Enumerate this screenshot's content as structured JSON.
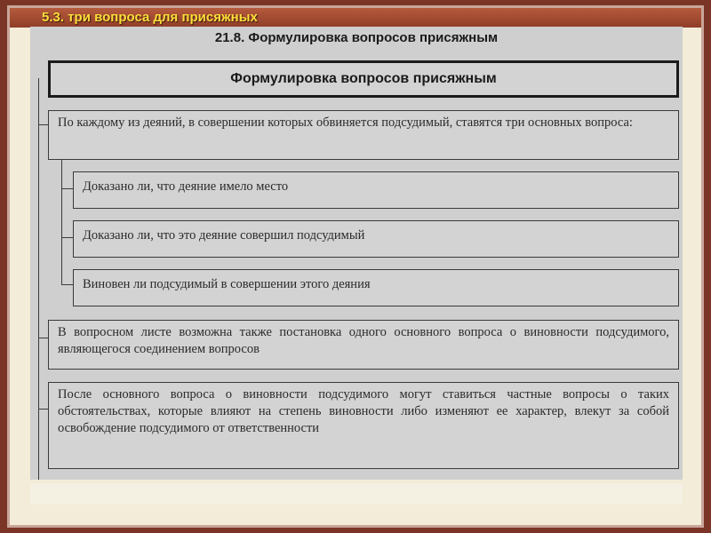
{
  "slide": {
    "title": "5.3. три вопроса для присяжных"
  },
  "diagram": {
    "heading": "21.8. Формулировка вопросов присяжным",
    "main_box": "Формулировка вопросов присяжным",
    "intro_box": "По каждому из деяний, в совершении которых обвиняется подсудимый, ставятся три основных вопроса:",
    "questions": [
      "Доказано ли, что деяние имело место",
      "Доказано ли, что это деяние совершил подсудимый",
      "Виновен ли подсудимый в совершении этого деяния"
    ],
    "note_box_1": "В вопросном листе возможна также постановка одного основного вопроса о виновности подсудимого, являющегося соединением вопросов",
    "note_box_2": "После основного вопроса о виновности подсудимого могут ставиться частные вопросы о таких обстоятельствах, которые влияют на степень виновности либо изменяют ее характер, влекут за собой освобождение подсудимого от ответственности"
  },
  "colors": {
    "background": "#7a3526",
    "title_text": "#ffde3a",
    "panel": "#cfcfcf"
  }
}
